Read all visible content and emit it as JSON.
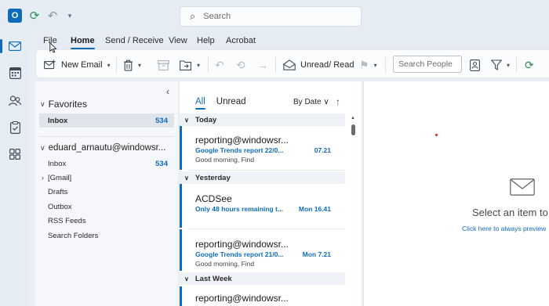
{
  "titlebar": {
    "app_logo": "O",
    "search_placeholder": "Search",
    "qat_dropdown": "▾"
  },
  "menu": {
    "tabs": [
      {
        "label": "File"
      },
      {
        "label": "Home"
      },
      {
        "label": "Send / Receive"
      },
      {
        "label": "View"
      },
      {
        "label": "Help"
      },
      {
        "label": "Acrobat"
      }
    ]
  },
  "ribbon": {
    "new_email_label": "New Email",
    "unread_read_label": "Unread/ Read",
    "search_people_placeholder": "Search People"
  },
  "folders": {
    "favorites_label": "Favorites",
    "favorites_inbox": {
      "label": "Inbox",
      "count": "534"
    },
    "account_label": "eduard_arnautu@windowsr...",
    "items": [
      {
        "label": "Inbox",
        "count": "534"
      },
      {
        "label": "[Gmail]",
        "count": ""
      },
      {
        "label": "Drafts",
        "count": ""
      },
      {
        "label": "Outbox",
        "count": ""
      },
      {
        "label": "RSS Feeds",
        "count": ""
      },
      {
        "label": "Search Folders",
        "count": ""
      }
    ]
  },
  "message_list": {
    "tab_all": "All",
    "tab_unread": "Unread",
    "sort_label": "By Date ∨",
    "groups": {
      "today": "Today",
      "yesterday": "Yesterday",
      "last_week": "Last Week"
    },
    "messages": [
      {
        "sender": "reporting@windowsr...",
        "subject": "Google Trends report 22/0...",
        "time": "07.21",
        "preview": "Good morning,  Find"
      },
      {
        "sender": "ACDSee",
        "subject": "Only 48 hours remaining t...",
        "time": "Mon 16.41",
        "preview": ""
      },
      {
        "sender": "reporting@windowsr...",
        "subject": "Google Trends report 21/0...",
        "time": "Mon 7.21",
        "preview": "Good morning,  Find"
      },
      {
        "sender": "reporting@windowsr...",
        "subject": "",
        "time": "",
        "preview": ""
      }
    ]
  },
  "reading_pane": {
    "title": "Select an item to",
    "link": "Click here to always preview"
  },
  "colors": {
    "accent": "#0f6cbd",
    "chrome": "#e6ecf4"
  }
}
